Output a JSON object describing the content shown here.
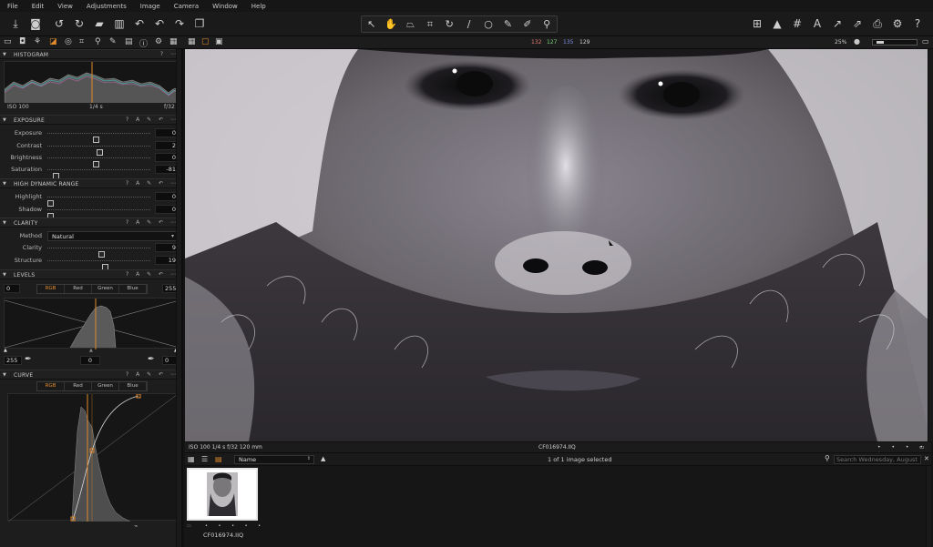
{
  "menu": [
    "File",
    "Edit",
    "View",
    "Adjustments",
    "Image",
    "Camera",
    "Window",
    "Help"
  ],
  "toolbar": {
    "left_icons": [
      "import-icon",
      "capture-icon",
      "rotate-left-icon",
      "rotate-right-icon",
      "folder-icon",
      "trash-icon",
      "undo-icon",
      "undo2-icon",
      "redo-icon",
      "copy-icon"
    ],
    "cursor_tools": [
      "select-cursor-icon",
      "hand-icon",
      "keystone-icon",
      "crop-icon",
      "rotate-straighten-icon",
      "line-icon",
      "circle-icon",
      "brush-icon",
      "eraser-icon",
      "picker-icon"
    ],
    "right_icons": [
      "layout-icon",
      "warning-icon",
      "grid-icon",
      "text-icon",
      "arrow-up-icon",
      "arrow-exit-icon",
      "print-icon",
      "settings-icon",
      "help-icon"
    ]
  },
  "readout": {
    "r": "132",
    "g": "127",
    "b": "135",
    "l": "129"
  },
  "zoom": "25%",
  "histogram": {
    "title": "HISTOGRAM",
    "iso": "ISO 100",
    "shutter": "1/4 s",
    "aperture": "f/32"
  },
  "exposure": {
    "title": "EXPOSURE",
    "rows": [
      {
        "label": "Exposure",
        "value": "0",
        "pos": 0.47
      },
      {
        "label": "Contrast",
        "value": "2",
        "pos": 0.51
      },
      {
        "label": "Brightness",
        "value": "0",
        "pos": 0.47
      },
      {
        "label": "Saturation",
        "value": "-81",
        "pos": 0.06
      }
    ]
  },
  "hdr": {
    "title": "HIGH DYNAMIC RANGE",
    "rows": [
      {
        "label": "Highlight",
        "value": "0",
        "pos": 0.0
      },
      {
        "label": "Shadow",
        "value": "0",
        "pos": 0.0
      }
    ]
  },
  "clarity": {
    "title": "CLARITY",
    "method_label": "Method",
    "method_value": "Natural",
    "rows": [
      {
        "label": "Clarity",
        "value": "9",
        "pos": 0.53
      },
      {
        "label": "Structure",
        "value": "19",
        "pos": 0.57
      }
    ]
  },
  "levels": {
    "title": "LEVELS",
    "in_low": "0",
    "in_high": "255",
    "tabs": [
      "RGB",
      "Red",
      "Green",
      "Blue"
    ],
    "out_low": "255",
    "out_mid": "0",
    "out_high": "0"
  },
  "curve": {
    "title": "CURVE",
    "tabs": [
      "RGB",
      "Red",
      "Green",
      "Blue"
    ]
  },
  "viewer": {
    "info": "ISO 100 1/4 s f/32 120 mm",
    "filename": "CF016974.IIQ"
  },
  "browser": {
    "sort": "Name",
    "selection": "1 of 1 image selected",
    "search_placeholder": "Search Wednesday, August",
    "thumb_name": "CF016974.IIQ"
  },
  "colors": {
    "accent": "#e08a2c",
    "panel": "#1d1d1d"
  }
}
